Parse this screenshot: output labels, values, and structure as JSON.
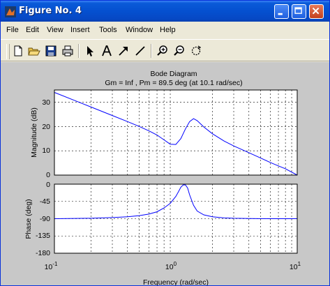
{
  "window": {
    "title": "Figure No. 4",
    "icon": "matlab-icon"
  },
  "menubar": {
    "items": [
      "File",
      "Edit",
      "View",
      "Insert",
      "Tools",
      "Window",
      "Help"
    ]
  },
  "toolbar": {
    "buttons": [
      "new-file-icon",
      "open-folder-icon",
      "save-icon",
      "print-icon",
      "select-arrow-icon",
      "insert-text-icon",
      "insert-arrow-icon",
      "insert-line-icon",
      "zoom-in-icon",
      "zoom-out-icon",
      "rotate-icon"
    ]
  },
  "figure": {
    "title": "Bode Diagram",
    "subtitle": "Gm = Inf ,  Pm = 89.5 deg (at 10.1 rad/sec)",
    "xlabel": "Frequency  (rad/sec)",
    "mag_ylabel": "Magnitude (dB)",
    "phase_ylabel": "Phase (deg)",
    "mag_ticks": [
      "0",
      "10",
      "20",
      "30"
    ],
    "phase_ticks": [
      "-180",
      "-135",
      "-90",
      "-45",
      "0"
    ],
    "x_ticks": [
      {
        "base": "10",
        "exp": "-1"
      },
      {
        "base": "10",
        "exp": "0"
      },
      {
        "base": "10",
        "exp": "1"
      }
    ]
  },
  "chart_data": [
    {
      "type": "line",
      "title": "Bode Diagram",
      "subtitle": "Gm = Inf ,  Pm = 89.5 deg (at 10.1 rad/sec)",
      "xlabel": "Frequency  (rad/sec)",
      "ylabel": "Magnitude (dB)",
      "xscale": "log",
      "xlim": [
        0.1,
        10
      ],
      "ylim": [
        0,
        35
      ],
      "grid": true,
      "series": [
        {
          "x": [
            0.1,
            0.15,
            0.2,
            0.3,
            0.4,
            0.5,
            0.6,
            0.7,
            0.8,
            0.9,
            1.0,
            1.1,
            1.2,
            1.3,
            1.4,
            1.5,
            1.7,
            2.0,
            2.5,
            3.0,
            4.0,
            5.0,
            6.0,
            7.0,
            8.0,
            10.0
          ],
          "y": [
            34.0,
            30.5,
            28.0,
            24.5,
            22.0,
            20.0,
            18.2,
            16.5,
            14.5,
            12.7,
            12.6,
            15.0,
            19.0,
            22.0,
            23.2,
            22.4,
            19.8,
            17.0,
            14.0,
            12.0,
            9.2,
            7.0,
            5.2,
            3.8,
            2.6,
            0.0
          ]
        }
      ]
    },
    {
      "type": "line",
      "xlabel": "Frequency  (rad/sec)",
      "ylabel": "Phase (deg)",
      "xscale": "log",
      "xlim": [
        0.1,
        10
      ],
      "ylim": [
        -180,
        0
      ],
      "grid": true,
      "series": [
        {
          "x": [
            0.1,
            0.2,
            0.3,
            0.4,
            0.5,
            0.6,
            0.7,
            0.8,
            0.9,
            1.0,
            1.05,
            1.1,
            1.15,
            1.2,
            1.25,
            1.3,
            1.4,
            1.5,
            1.7,
            2.0,
            2.5,
            3.0,
            4.0,
            6.0,
            10.0
          ],
          "y": [
            -90,
            -89,
            -87,
            -85,
            -82,
            -78,
            -72,
            -62,
            -50,
            -32,
            -20,
            -8,
            -2,
            -2,
            -10,
            -28,
            -55,
            -70,
            -80,
            -85,
            -88,
            -89,
            -89.5,
            -90,
            -90
          ]
        }
      ]
    }
  ]
}
